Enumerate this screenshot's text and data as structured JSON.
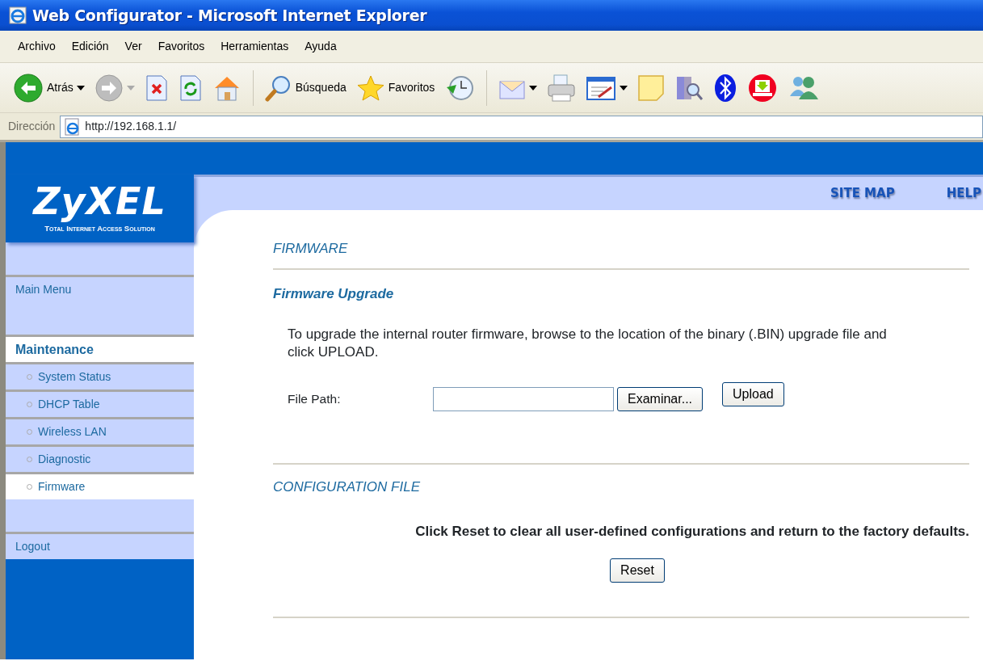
{
  "window": {
    "title": "Web Configurator - Microsoft Internet Explorer"
  },
  "menu_bar": [
    "Archivo",
    "Edición",
    "Ver",
    "Favoritos",
    "Herramientas",
    "Ayuda"
  ],
  "toolbar": [
    {
      "kind": "back",
      "label": "Atrás",
      "dropdown": true
    },
    {
      "kind": "forward",
      "dropdown": true
    },
    {
      "kind": "stop"
    },
    {
      "kind": "refresh"
    },
    {
      "kind": "home"
    },
    {
      "kind": "separator"
    },
    {
      "kind": "search",
      "label": "Búsqueda"
    },
    {
      "kind": "favorites",
      "label": "Favoritos"
    },
    {
      "kind": "history"
    },
    {
      "kind": "separator"
    },
    {
      "kind": "mail",
      "dropdown": true
    },
    {
      "kind": "print"
    },
    {
      "kind": "edit",
      "dropdown": true
    },
    {
      "kind": "note"
    },
    {
      "kind": "research"
    },
    {
      "kind": "bluetooth"
    },
    {
      "kind": "download"
    },
    {
      "kind": "messenger"
    }
  ],
  "address_bar": {
    "label": "Dirección",
    "url": "http://192.168.1.1/"
  },
  "header_links": [
    "SITE MAP",
    "HELP"
  ],
  "logo": {
    "brand": "ZyXEL",
    "tagline": "Total Internet Access Solution"
  },
  "sidebar": {
    "items": [
      {
        "kind": "blank"
      },
      {
        "kind": "link",
        "label": "Main Menu",
        "selected": false
      },
      {
        "kind": "blank"
      },
      {
        "kind": "heading",
        "label": "Maintenance",
        "selected": true
      },
      {
        "kind": "sub",
        "label": "System Status",
        "selected": false
      },
      {
        "kind": "sub",
        "label": "DHCP Table",
        "selected": false
      },
      {
        "kind": "sub",
        "label": "Wireless LAN",
        "selected": false
      },
      {
        "kind": "sub",
        "label": "Diagnostic",
        "selected": false
      },
      {
        "kind": "sub",
        "label": "Firmware",
        "selected": true
      },
      {
        "kind": "blank"
      },
      {
        "kind": "link",
        "label": "Logout",
        "selected": false
      }
    ]
  },
  "page": {
    "title": "FIRMWARE",
    "upgrade": {
      "title": "Firmware Upgrade",
      "text": "To upgrade the internal router firmware, browse to the location of the binary (.BIN) upgrade file and click UPLOAD.",
      "field_label": "File Path:",
      "browse_button": "Examinar...",
      "upload_button": "Upload"
    },
    "config": {
      "title": "CONFIGURATION FILE",
      "text": "Click Reset to clear all user-defined configurations and return to the factory defaults.",
      "reset_button": "Reset"
    }
  }
}
